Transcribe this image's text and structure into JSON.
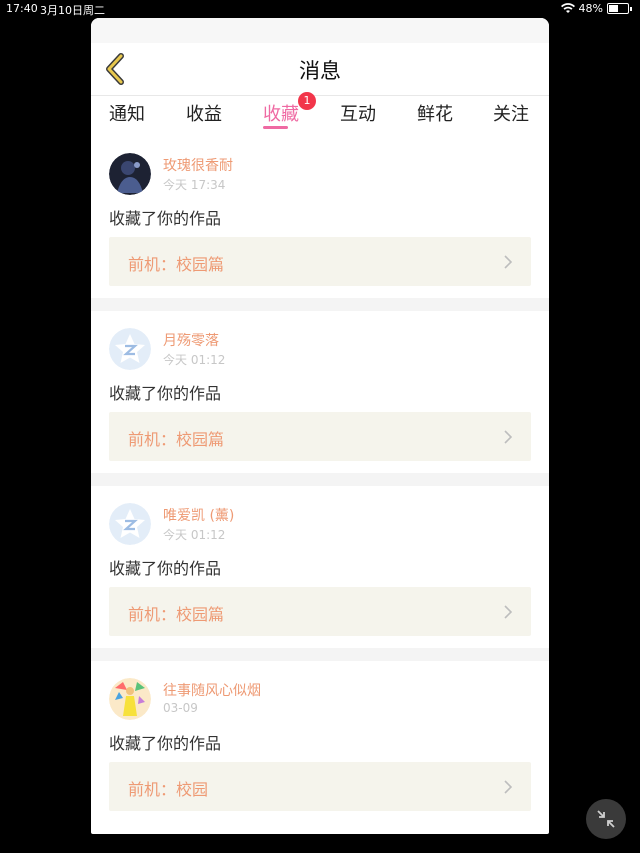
{
  "status_bar": {
    "time": "17:40",
    "date": "3月10日周二",
    "battery": "48%",
    "battery_level": 0.48
  },
  "nav": {
    "title": "消息"
  },
  "tabs": {
    "items": [
      "通知",
      "收益",
      "收藏",
      "互动",
      "鲜花",
      "关注"
    ],
    "active": "收藏",
    "badge": "1"
  },
  "messages": [
    {
      "name": "玫瑰很香耐",
      "time": "今天 17:34",
      "action": "收藏了你的作品",
      "work": "前机：校园篇",
      "avatar": "dark-photo"
    },
    {
      "name": "月殇零落",
      "time": "今天 01:12",
      "action": "收藏了你的作品",
      "work": "前机：校园篇",
      "avatar": "default-star"
    },
    {
      "name": "唯爱凯 (薰)",
      "time": "今天 01:12",
      "action": "收藏了你的作品",
      "work": "前机：校园篇",
      "avatar": "default-star"
    },
    {
      "name": "往事随风心似烟",
      "time": "03-09",
      "action": "收藏了你的作品",
      "work": "前机：校园",
      "avatar": "colorful-illustration"
    }
  ],
  "colors": {
    "accent_pink": "#ef6aa3",
    "name_orange": "#ee9a74",
    "badge_red": "#f2354a",
    "work_box_bg": "#f5f4ec",
    "back_arrow_yellow": "#e8c84e"
  }
}
